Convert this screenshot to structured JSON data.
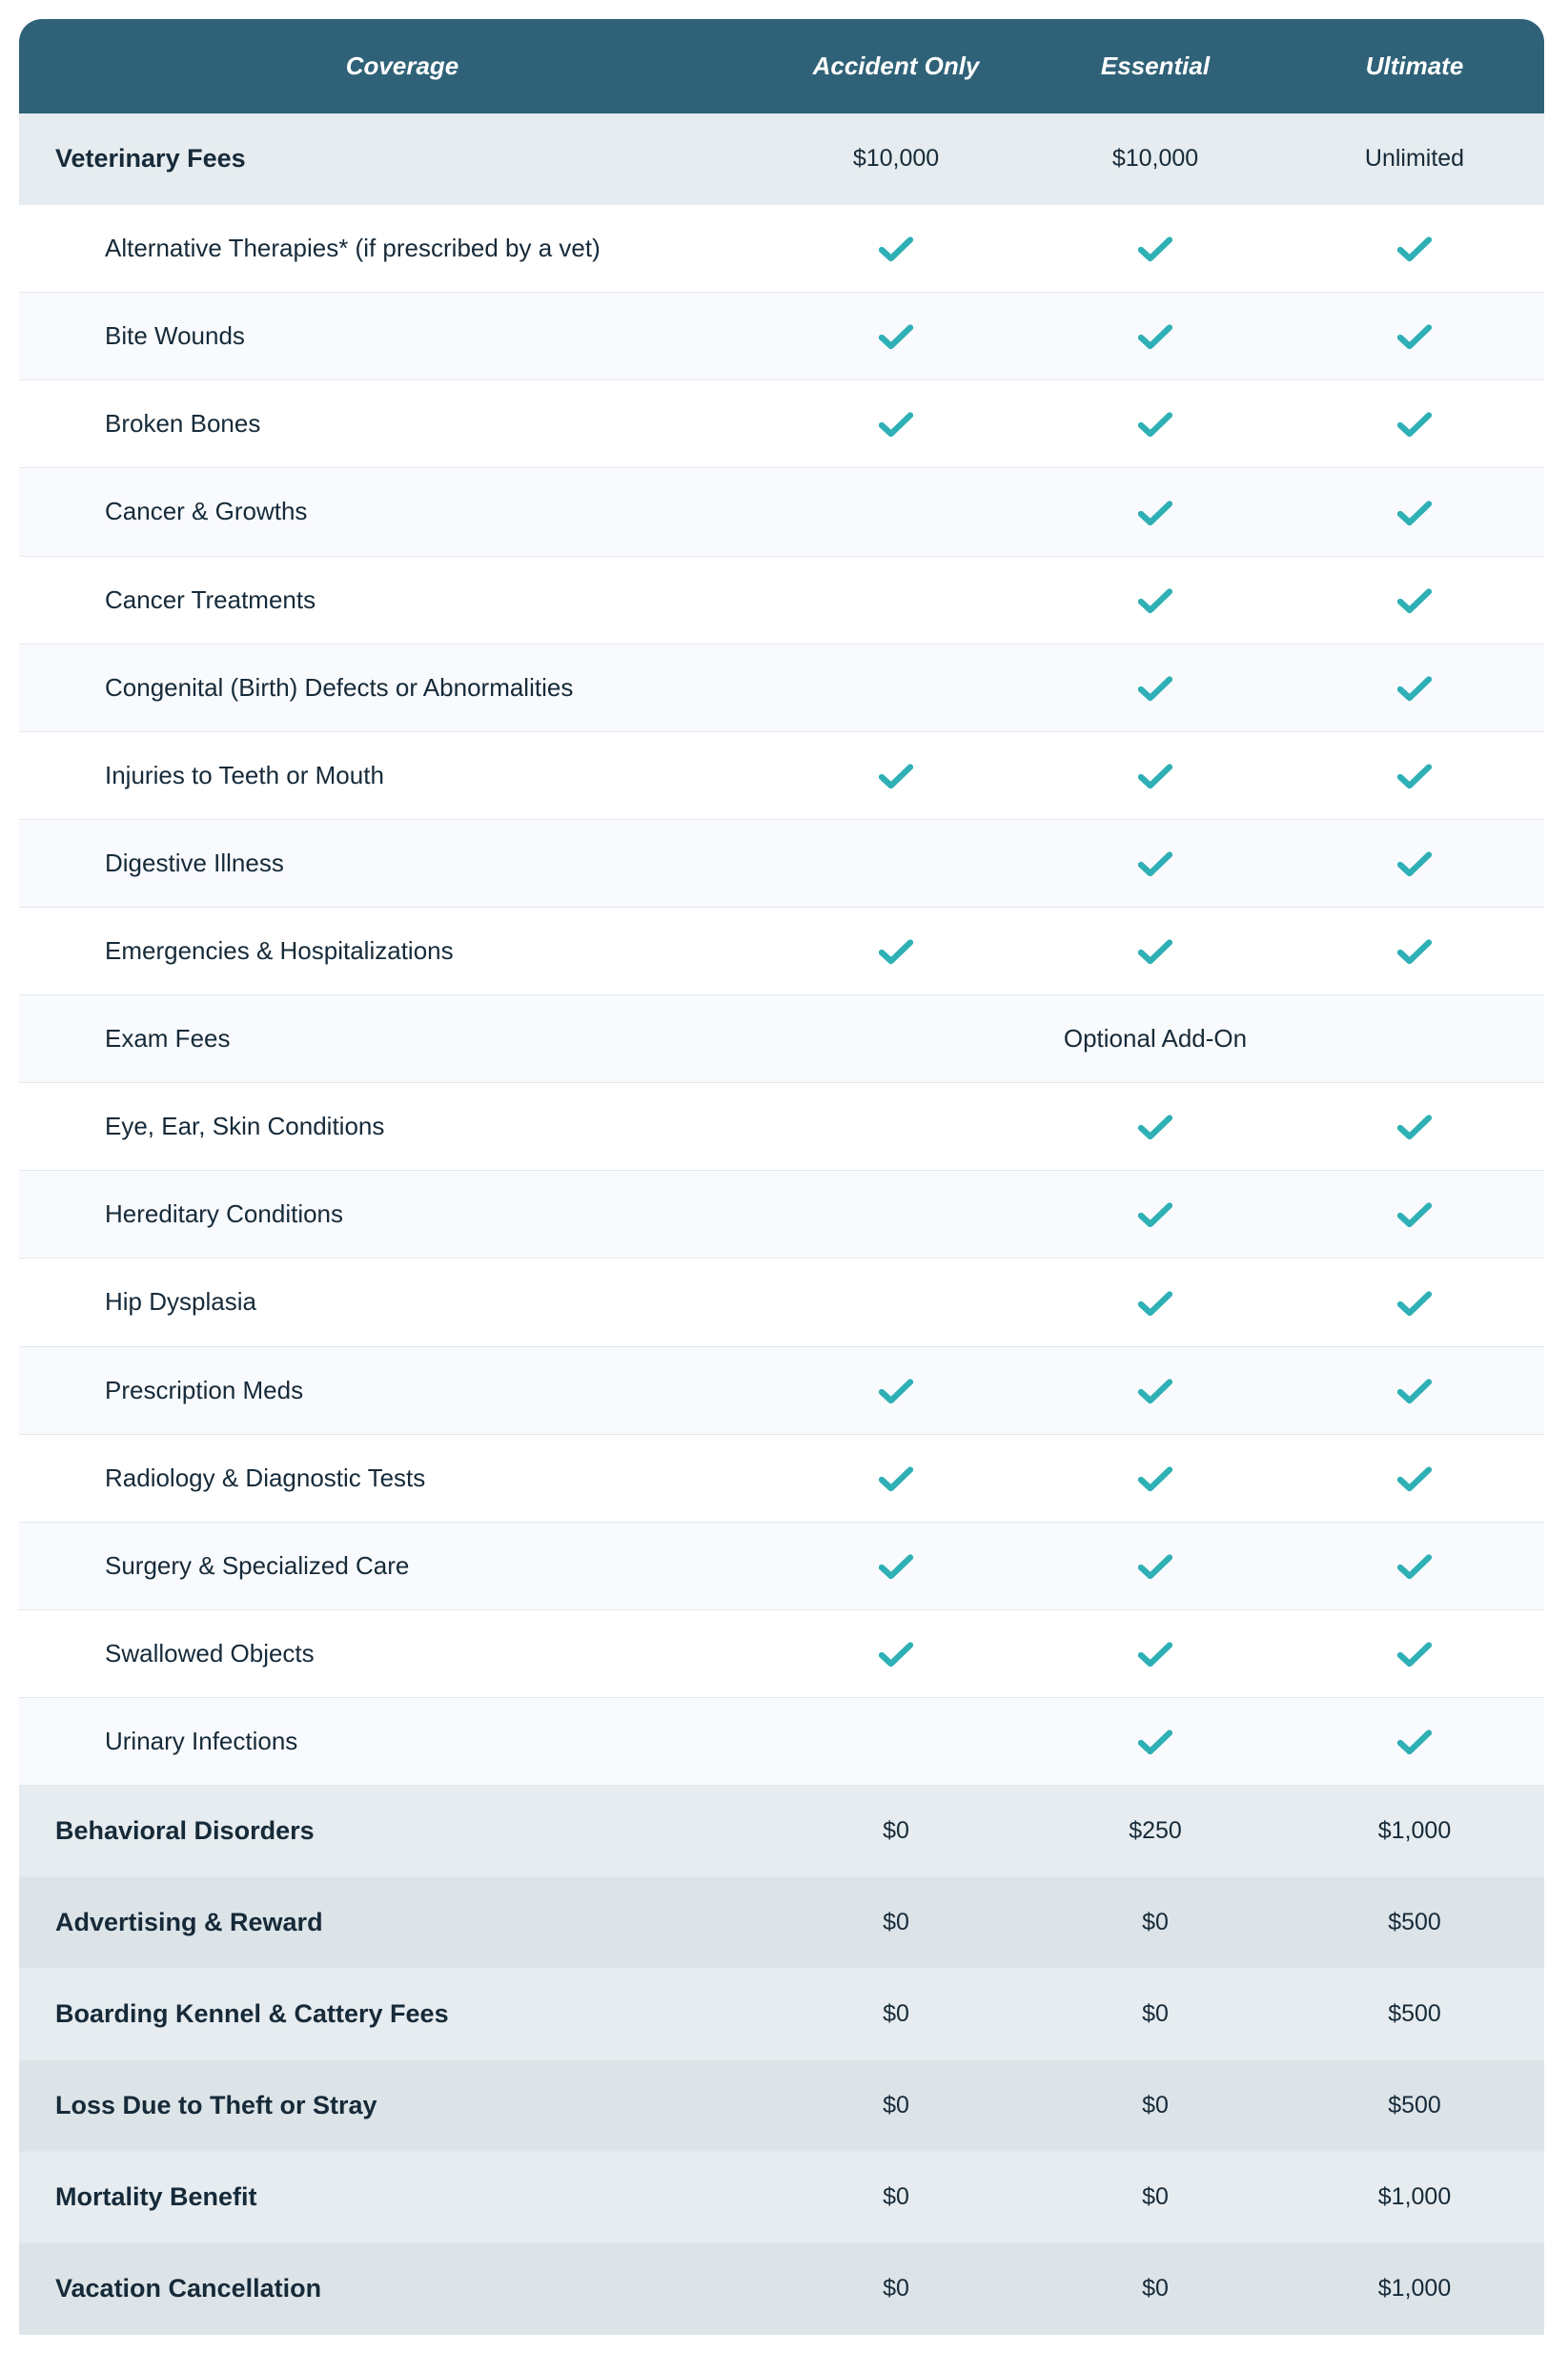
{
  "colors": {
    "header_bg": "#2f6278",
    "check": "#2eb0b5",
    "text": "#162a39"
  },
  "header": {
    "coverage": "Coverage",
    "plans": [
      "Accident Only",
      "Essential",
      "Ultimate"
    ]
  },
  "sections": [
    {
      "label": "Veterinary Fees",
      "values": [
        "$10,000",
        "$10,000",
        "Unlimited"
      ],
      "subitems": [
        {
          "label": "Alternative Therapies* (if prescribed by a vet)",
          "cells": [
            "check",
            "check",
            "check"
          ]
        },
        {
          "label": "Bite Wounds",
          "cells": [
            "check",
            "check",
            "check"
          ]
        },
        {
          "label": "Broken Bones",
          "cells": [
            "check",
            "check",
            "check"
          ]
        },
        {
          "label": "Cancer & Growths",
          "cells": [
            "",
            "check",
            "check"
          ]
        },
        {
          "label": "Cancer Treatments",
          "cells": [
            "",
            "check",
            "check"
          ]
        },
        {
          "label": "Congenital (Birth) Defects or Abnormalities",
          "cells": [
            "",
            "check",
            "check"
          ]
        },
        {
          "label": "Injuries to Teeth or Mouth",
          "cells": [
            "check",
            "check",
            "check"
          ]
        },
        {
          "label": "Digestive Illness",
          "cells": [
            "",
            "check",
            "check"
          ]
        },
        {
          "label": "Emergencies & Hospitalizations",
          "cells": [
            "check",
            "check",
            "check"
          ]
        },
        {
          "label": "Exam Fees",
          "span": "Optional Add-On"
        },
        {
          "label": "Eye, Ear, Skin Conditions",
          "cells": [
            "",
            "check",
            "check"
          ]
        },
        {
          "label": "Hereditary Conditions",
          "cells": [
            "",
            "check",
            "check"
          ]
        },
        {
          "label": "Hip Dysplasia",
          "cells": [
            "",
            "check",
            "check"
          ]
        },
        {
          "label": "Prescription Meds",
          "cells": [
            "check",
            "check",
            "check"
          ]
        },
        {
          "label": "Radiology & Diagnostic Tests",
          "cells": [
            "check",
            "check",
            "check"
          ]
        },
        {
          "label": "Surgery & Specialized Care",
          "cells": [
            "check",
            "check",
            "check"
          ]
        },
        {
          "label": "Swallowed Objects",
          "cells": [
            "check",
            "check",
            "check"
          ]
        },
        {
          "label": "Urinary Infections",
          "cells": [
            "",
            "check",
            "check"
          ]
        }
      ]
    },
    {
      "label": "Behavioral Disorders",
      "values": [
        "$0",
        "$250",
        "$1,000"
      ]
    },
    {
      "label": "Advertising & Reward",
      "values": [
        "$0",
        "$0",
        "$500"
      ]
    },
    {
      "label": "Boarding Kennel & Cattery Fees",
      "values": [
        "$0",
        "$0",
        "$500"
      ]
    },
    {
      "label": "Loss Due to Theft or Stray",
      "values": [
        "$0",
        "$0",
        "$500"
      ]
    },
    {
      "label": "Mortality Benefit",
      "values": [
        "$0",
        "$0",
        "$1,000"
      ]
    },
    {
      "label": "Vacation Cancellation",
      "values": [
        "$0",
        "$0",
        "$1,000"
      ]
    }
  ]
}
